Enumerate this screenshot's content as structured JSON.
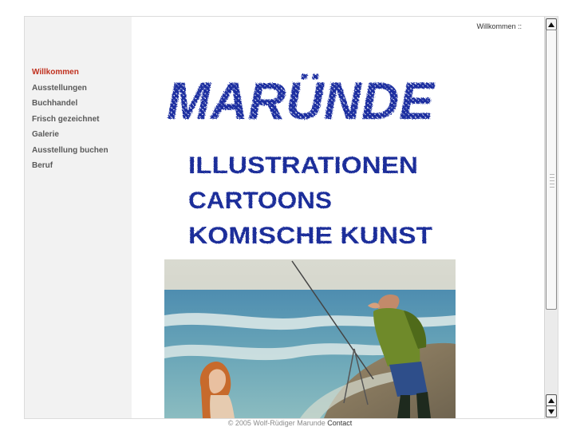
{
  "breadcrumb": "Willkommen ::",
  "nav": [
    {
      "label": "Willkommen",
      "active": true
    },
    {
      "label": "Ausstellungen",
      "active": false
    },
    {
      "label": "Buchhandel",
      "active": false
    },
    {
      "label": "Frisch gezeichnet",
      "active": false
    },
    {
      "label": "Galerie",
      "active": false
    },
    {
      "label": "Ausstellung buchen",
      "active": false
    },
    {
      "label": "Beruf",
      "active": false
    }
  ],
  "logo_text": "MARÜNDE",
  "taglines": [
    "ILLUSTRATIONEN",
    "CARTOONS",
    "KOMISCHE KUNST"
  ],
  "footer": {
    "copyright": "© 2005 Wolf-Rüdiger Marunde",
    "contact_label": "Contact"
  },
  "colors": {
    "active_nav": "#c0301e",
    "logo_blue": "#1c2fa0",
    "sidebar_bg": "#f2f2f2"
  },
  "icons": {
    "scroll_up": "triangle-up-icon",
    "scroll_down": "triangle-down-icon"
  }
}
